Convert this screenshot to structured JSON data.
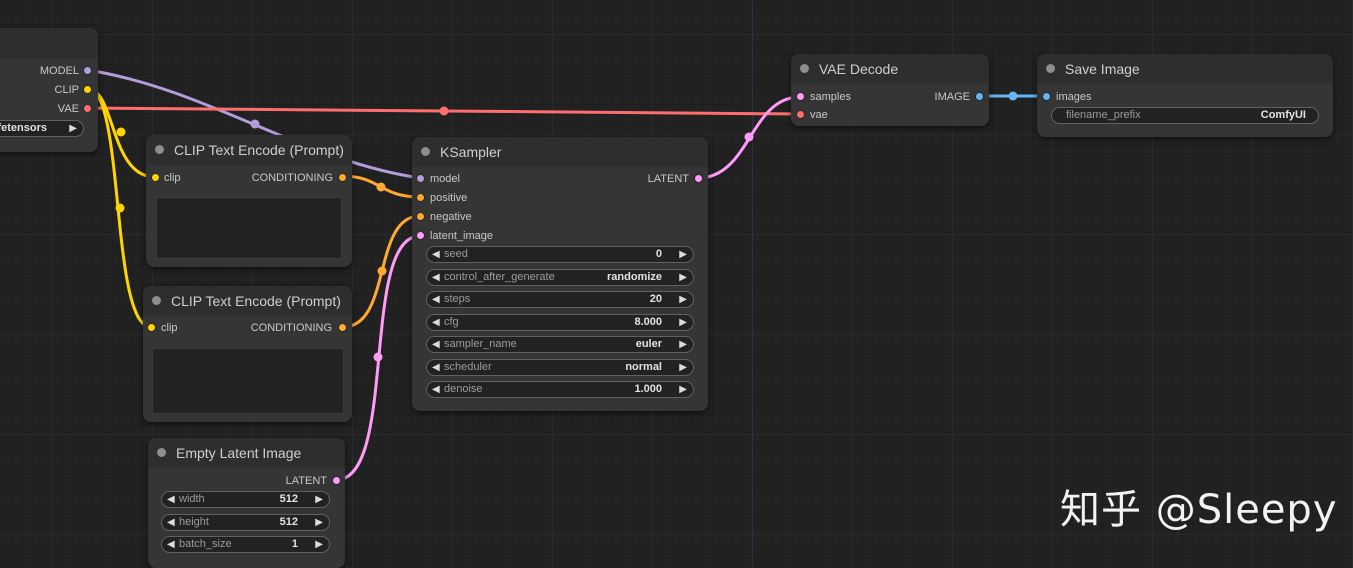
{
  "colors": {
    "model": "#b39ddb",
    "clip": "#ffd500",
    "vae": "#ff6e6e",
    "conditioning": "#ffa931",
    "latent": "#ff9cf9",
    "image": "#64b5f6"
  },
  "checkpoint_loader": {
    "outputs": [
      "MODEL",
      "CLIP",
      "VAE"
    ],
    "ckpt_name_value": "afetensors"
  },
  "clip_encode_1": {
    "title": "CLIP Text Encode (Prompt)",
    "input": "clip",
    "output": "CONDITIONING"
  },
  "clip_encode_2": {
    "title": "CLIP Text Encode (Prompt)",
    "input": "clip",
    "output": "CONDITIONING"
  },
  "empty_latent": {
    "title": "Empty Latent Image",
    "output": "LATENT",
    "widgets": [
      {
        "name": "width",
        "value": "512"
      },
      {
        "name": "height",
        "value": "512"
      },
      {
        "name": "batch_size",
        "value": "1"
      }
    ]
  },
  "ksampler": {
    "title": "KSampler",
    "inputs": [
      "model",
      "positive",
      "negative",
      "latent_image"
    ],
    "output": "LATENT",
    "widgets": [
      {
        "name": "seed",
        "value": "0"
      },
      {
        "name": "control_after_generate",
        "value": "randomize"
      },
      {
        "name": "steps",
        "value": "20"
      },
      {
        "name": "cfg",
        "value": "8.000"
      },
      {
        "name": "sampler_name",
        "value": "euler"
      },
      {
        "name": "scheduler",
        "value": "normal"
      },
      {
        "name": "denoise",
        "value": "1.000"
      }
    ]
  },
  "vae_decode": {
    "title": "VAE Decode",
    "inputs": [
      "samples",
      "vae"
    ],
    "output": "IMAGE"
  },
  "save_image": {
    "title": "Save Image",
    "input": "images",
    "widget": {
      "name": "filename_prefix",
      "value": "ComfyUI"
    }
  },
  "arrows": {
    "left": "◀",
    "right": "▶"
  },
  "watermark": "知乎 @Sleepy"
}
